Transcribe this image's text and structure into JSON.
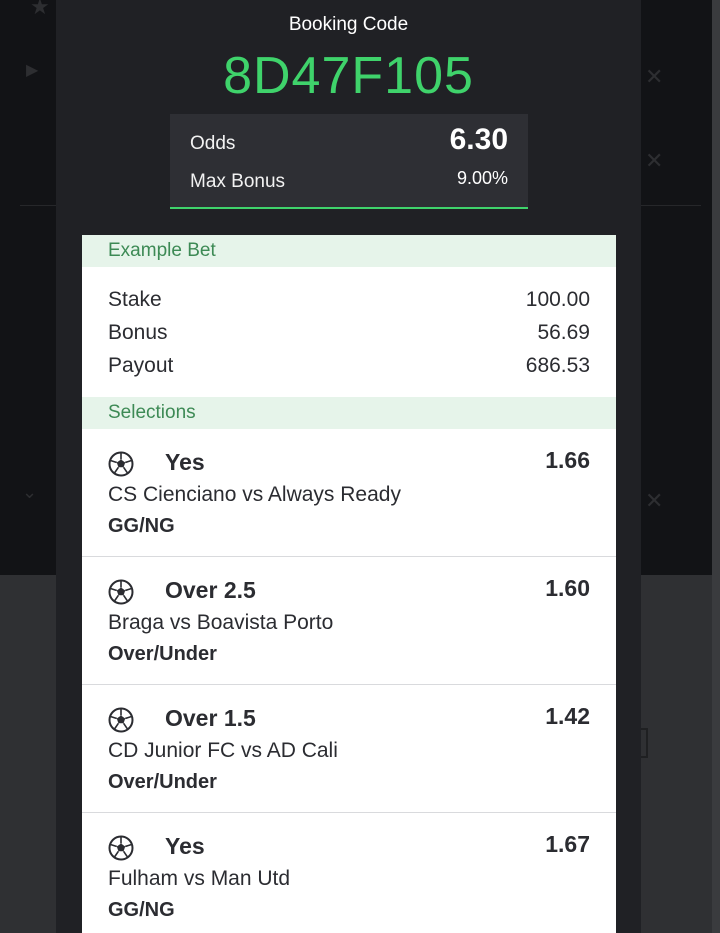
{
  "modal": {
    "title": "Booking Code",
    "code": "8D47F105",
    "odds_label": "Odds",
    "odds_value": "6.30",
    "max_bonus_label": "Max Bonus",
    "max_bonus_value": "9.00%"
  },
  "example_bet": {
    "heading": "Example Bet",
    "rows": [
      {
        "label": "Stake",
        "value": "100.00"
      },
      {
        "label": "Bonus",
        "value": "56.69"
      },
      {
        "label": "Payout",
        "value": "686.53"
      }
    ]
  },
  "selections": {
    "heading": "Selections",
    "items": [
      {
        "icon": "soccer-ball-icon",
        "pick": "Yes",
        "odds": "1.66",
        "match": "CS Cienciano vs Always Ready",
        "market": "GG/NG"
      },
      {
        "icon": "soccer-ball-icon",
        "pick": "Over 2.5",
        "odds": "1.60",
        "match": "Braga vs Boavista Porto",
        "market": "Over/Under"
      },
      {
        "icon": "soccer-ball-icon",
        "pick": "Over 1.5",
        "odds": "1.42",
        "match": "CD Junior FC vs AD Cali",
        "market": "Over/Under"
      },
      {
        "icon": "soccer-ball-icon",
        "pick": "Yes",
        "odds": "1.67",
        "match": "Fulham vs Man Utd",
        "market": "GG/NG"
      }
    ]
  },
  "colors": {
    "accent": "#3fd36b",
    "section_bg": "#e6f4ea",
    "section_text": "#3d8a55",
    "modal_bg": "#202125"
  }
}
